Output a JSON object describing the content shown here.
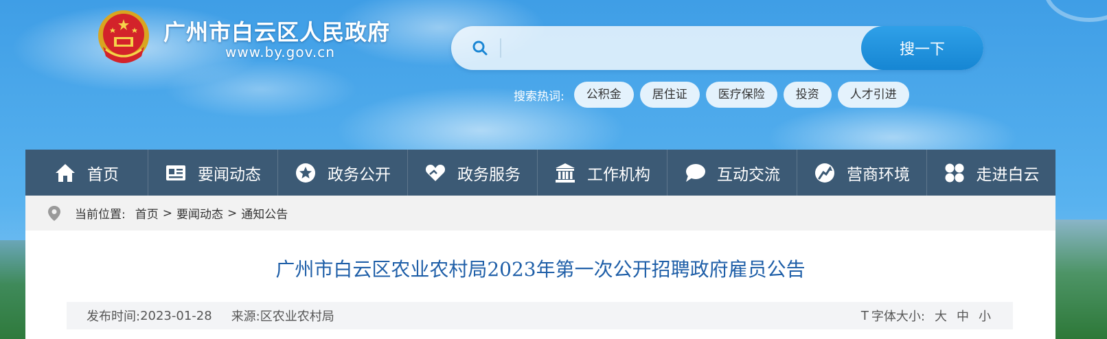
{
  "header": {
    "site_title": "广州市白云区人民政府",
    "site_domain": "www.by.gov.cn"
  },
  "search": {
    "placeholder": "",
    "button_label": "搜一下",
    "hot_label": "搜索热词:",
    "hot_words": [
      "公积金",
      "居住证",
      "医疗保险",
      "投资",
      "人才引进"
    ]
  },
  "nav": {
    "items": [
      {
        "label": "首页",
        "icon": "home-icon"
      },
      {
        "label": "要闻动态",
        "icon": "news-card-icon"
      },
      {
        "label": "政务公开",
        "icon": "star-badge-icon"
      },
      {
        "label": "政务服务",
        "icon": "heart-hand-icon"
      },
      {
        "label": "工作机构",
        "icon": "government-building-icon"
      },
      {
        "label": "互动交流",
        "icon": "chat-bubble-icon"
      },
      {
        "label": "营商环境",
        "icon": "growth-arrow-icon"
      },
      {
        "label": "走进白云",
        "icon": "grid-clover-icon"
      }
    ]
  },
  "breadcrumb": {
    "label": "当前位置:",
    "items": [
      "首页",
      "要闻动态",
      "通知公告"
    ],
    "separator": ">"
  },
  "article": {
    "title": "广州市白云区农业农村局2023年第一次公开招聘政府雇员公告",
    "publish_label": "发布时间:",
    "publish_date": "2023-01-28",
    "source_label": "来源:",
    "source": "区农业农村局",
    "font_icon": "T",
    "font_size_label": "字体大小:",
    "font_sizes": [
      "大",
      "中",
      "小"
    ]
  },
  "colors": {
    "nav_bg": "#3c5a75",
    "title_blue": "#1f5fa8",
    "search_button": "#1686d3"
  }
}
